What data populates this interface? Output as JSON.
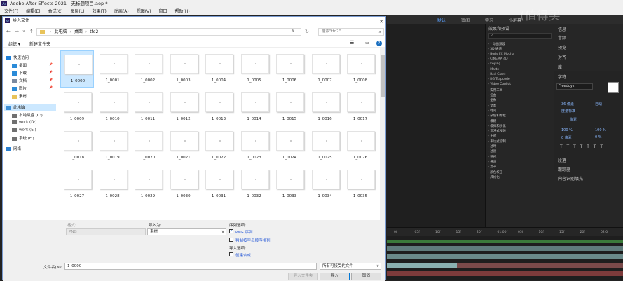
{
  "app": {
    "title": "Adobe After Effects 2021 - 无标题项目.aep *",
    "logo": "Ae",
    "menu": [
      "文件(F)",
      "编辑(E)",
      "合成(C)",
      "图层(L)",
      "效果(T)",
      "动画(A)",
      "视图(V)",
      "窗口",
      "帮助(H)"
    ]
  },
  "workspace": [
    "默认",
    "审阅",
    "学习",
    "小屏幕"
  ],
  "effects_panel": {
    "title": "效果和预设",
    "search_placeholder": "P",
    "items": [
      "* 动画预设",
      "3D 通道",
      "Boris FX Mocha",
      "CINEMA 4D",
      "Keying",
      "Matte",
      "Red Giant",
      "RG Trapcode",
      "Video Copilot",
      "实用工具",
      "扭曲",
      "抠像",
      "文本",
      "时间",
      "杂色和颗粒",
      "模糊",
      "模拟和锐化",
      "沉浸式视频",
      "生成",
      "表达式控制",
      "过时",
      "过渡",
      "透视",
      "通道",
      "遮罩",
      "颜色校正",
      "风格化"
    ]
  },
  "side_panel": {
    "tabs": [
      "信息",
      "音频",
      "预览",
      "对齐",
      "库",
      "字符"
    ],
    "character": {
      "font": "Freedoys",
      "size": "36 像素",
      "leading": "自动",
      "tracking": "度量标准",
      "stroke": "像素",
      "scale_v": "100 %",
      "scale_h": "100 %",
      "baseline": "0 像素",
      "tsume": "0 %"
    },
    "bottom_tabs": [
      "段落",
      "跟踪器",
      "内容识别填充"
    ]
  },
  "timeline": {
    "ticks": [
      "0f",
      "05f",
      "10f",
      "15f",
      "20f",
      "01:00f",
      "05f",
      "10f",
      "15f",
      "20f",
      "02:0"
    ]
  },
  "dialog": {
    "title": "导入文件",
    "breadcrumb": [
      "此电脑",
      "桌面",
      "tfd2"
    ],
    "search_placeholder": "搜索\"tfd2\"",
    "toolbar": {
      "organize": "组织 ▾",
      "new_folder": "新建文件夹"
    },
    "nav": [
      {
        "label": "快速访问",
        "icon": "star-icon",
        "pinned": false
      },
      {
        "label": "桌面",
        "icon": "desktop-icon",
        "pinned": true
      },
      {
        "label": "下载",
        "icon": "download-icon",
        "pinned": true
      },
      {
        "label": "文档",
        "icon": "document-icon",
        "pinned": true
      },
      {
        "label": "图片",
        "icon": "picture-icon",
        "pinned": true
      },
      {
        "label": "素材",
        "icon": "folder-icon",
        "pinned": false
      },
      {
        "label": "此电脑",
        "icon": "computer-icon",
        "pinned": false
      },
      {
        "label": "本地磁盘 (C:)",
        "icon": "drive-icon",
        "pinned": false
      },
      {
        "label": "work (D:)",
        "icon": "drive-icon",
        "pinned": false
      },
      {
        "label": "work (E:)",
        "icon": "drive-icon",
        "pinned": false
      },
      {
        "label": "系统 (F:)",
        "icon": "drive-icon",
        "pinned": false
      },
      {
        "label": "网络",
        "icon": "network-icon",
        "pinned": false
      }
    ],
    "files": [
      "1_0000",
      "1_0001",
      "1_0002",
      "1_0003",
      "1_0004",
      "1_0005",
      "1_0006",
      "1_0007",
      "1_0008",
      "1_0009",
      "1_0010",
      "1_0011",
      "1_0012",
      "1_0013",
      "1_0014",
      "1_0015",
      "1_0016",
      "1_0017",
      "1_0018",
      "1_0019",
      "1_0020",
      "1_0021",
      "1_0022",
      "1_0023",
      "1_0024",
      "1_0025",
      "1_0026",
      "1_0027",
      "1_0028",
      "1_0029",
      "1_0030",
      "1_0031",
      "1_0032",
      "1_0033",
      "1_0034",
      "1_0035"
    ],
    "format_label": "格式:",
    "format_value": "PNG",
    "import_as_label": "导入为:",
    "import_as_value": "素材",
    "sequence_label": "序列选项:",
    "png_seq_label": "PNG 序列",
    "png_seq_checked": true,
    "alpha_order_label": "强制按字母顺序排列",
    "alpha_order_checked": false,
    "import_opts_label": "导入选项:",
    "create_comp_label": "创建合成",
    "create_comp_checked": false,
    "filename_label": "文件名(N):",
    "filename_value": "1_0000",
    "filetype_value": "所有可接受的文件",
    "import_folder_btn": "导入文件夹",
    "import_btn": "导入",
    "cancel_btn": "取消"
  },
  "watermark": "(值得买"
}
